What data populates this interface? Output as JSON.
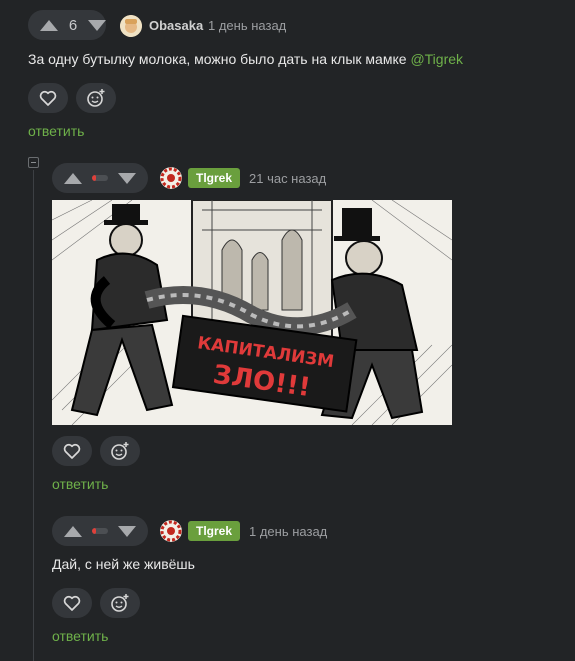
{
  "comment1": {
    "votes": "6",
    "username": "Obasaka",
    "time": "1 день назад",
    "text": "За одну бутылку молока, можно было дать на клык мамке ",
    "mention": "@Tigrek",
    "reply": "ответить"
  },
  "comment2": {
    "vote_ratio": 0.25,
    "username": "Tlgrek",
    "time": "21 час назад",
    "image": {
      "banner_line1": "КАПИТАЛИЗМ",
      "banner_line2": "ЗЛО!!!"
    },
    "reply": "ответить"
  },
  "comment3": {
    "vote_ratio": 0.25,
    "username": "Tlgrek",
    "time": "1 день назад",
    "text": "Дай, с ней же живёшь",
    "reply": "ответить"
  },
  "colors": {
    "accent_green": "#6fb14a",
    "badge_green": "#6a9f3d",
    "minus_red": "#e0403a"
  }
}
